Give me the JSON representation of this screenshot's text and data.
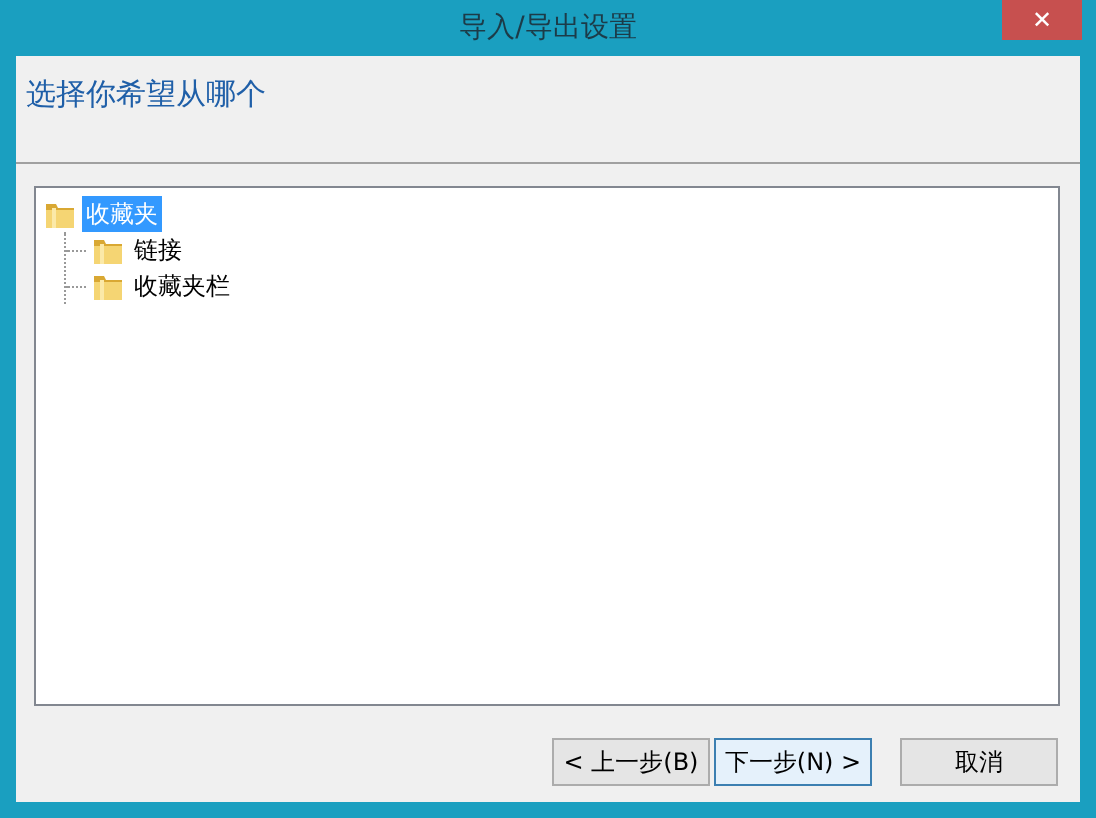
{
  "window": {
    "title": "导入/导出设置",
    "close": "✕"
  },
  "header": {
    "instruction": "选择你希望从哪个"
  },
  "tree": [
    {
      "label": "收藏夹",
      "selected": true,
      "children": [
        {
          "label": "链接",
          "selected": false
        },
        {
          "label": "收藏夹栏",
          "selected": false
        }
      ]
    }
  ],
  "buttons": [
    {
      "label": "< 上一步(B)",
      "focused": false
    },
    {
      "label": "下一步(N) >",
      "focused": true
    },
    {
      "label": "取消",
      "focused": false
    }
  ]
}
